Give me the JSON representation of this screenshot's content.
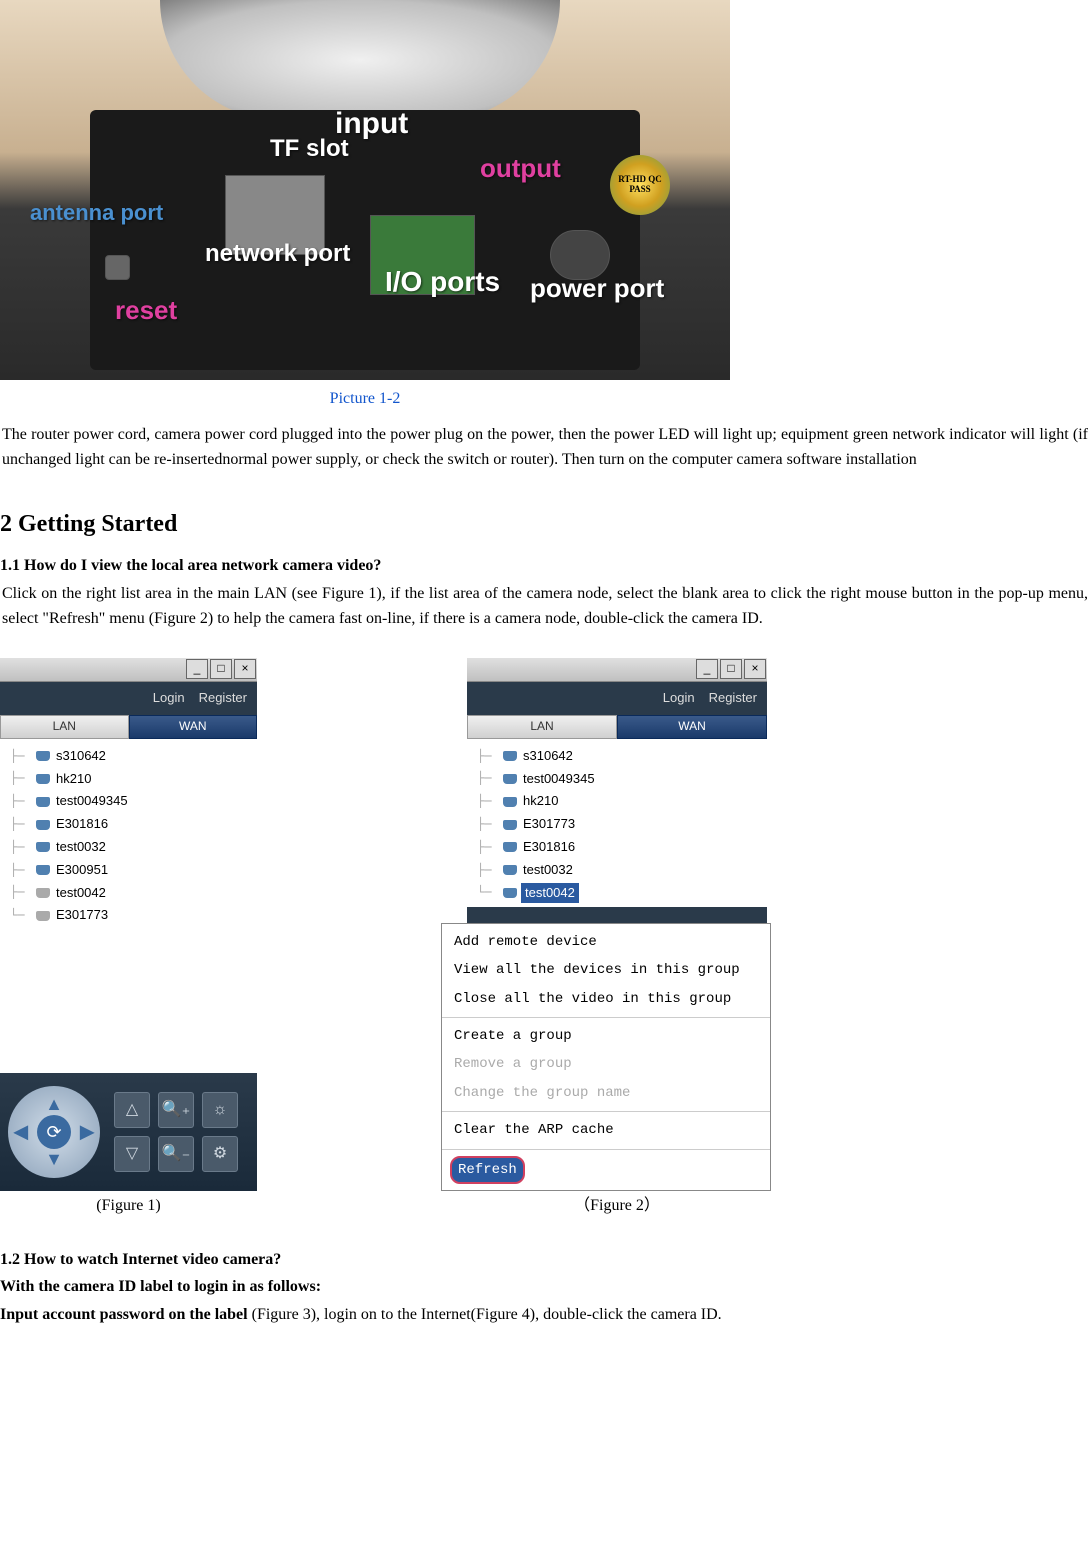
{
  "photo": {
    "labels": {
      "antenna": "antenna port",
      "reset": "reset",
      "tfslot": "TF slot",
      "input": "input",
      "output": "output",
      "network": "network port",
      "io": "I/O ports",
      "power": "power port",
      "sticker": "RT-HD QC PASS"
    },
    "caption": "Picture 1-2"
  },
  "intro_paragraph": "The router power cord, camera power cord plugged into the power plug on the power, then the power LED will light up; equipment green network indicator will light (if unchanged light can be re-insertednormal power supply, or check the switch or router). Then turn on the computer camera software installation",
  "section2": {
    "heading": "2 Getting Started",
    "sub1": {
      "title": "1.1 How do I view the local area network camera video?",
      "text": "Click on the right list area in the main LAN (see Figure 1), if the list area of the camera node, select the blank area to click the right mouse button in the pop-up menu, select \"Refresh\" menu (Figure 2) to help the camera fast on-line, if there is a camera node, double-click the camera ID."
    },
    "figure1": {
      "login": "Login",
      "register": "Register",
      "tab_lan": "LAN",
      "tab_wan": "WAN",
      "tree": [
        {
          "id": "s310642",
          "online": true
        },
        {
          "id": "hk210",
          "online": true
        },
        {
          "id": "test0049345",
          "online": true
        },
        {
          "id": "E301816",
          "online": true
        },
        {
          "id": "test0032",
          "online": true
        },
        {
          "id": "E300951",
          "online": true
        },
        {
          "id": "test0042",
          "online": false
        },
        {
          "id": "E301773",
          "online": false
        }
      ],
      "caption": "(Figure 1)"
    },
    "figure2": {
      "login": "Login",
      "register": "Register",
      "tab_lan": "LAN",
      "tab_wan": "WAN",
      "tree": [
        {
          "id": "s310642",
          "online": true,
          "selected": false
        },
        {
          "id": "test0049345",
          "online": true,
          "selected": false
        },
        {
          "id": "hk210",
          "online": true,
          "selected": false
        },
        {
          "id": "E301773",
          "online": true,
          "selected": false
        },
        {
          "id": "E301816",
          "online": true,
          "selected": false
        },
        {
          "id": "test0032",
          "online": true,
          "selected": false
        },
        {
          "id": "test0042",
          "online": true,
          "selected": true
        }
      ],
      "menu": {
        "sect1": [
          {
            "label": "Add remote device",
            "enabled": true
          },
          {
            "label": "View all the devices in this group",
            "enabled": true
          },
          {
            "label": "Close all the video in this group",
            "enabled": true
          }
        ],
        "sect2": [
          {
            "label": "Create a group",
            "enabled": true
          },
          {
            "label": "Remove a group",
            "enabled": false
          },
          {
            "label": "Change the group name",
            "enabled": false
          }
        ],
        "sect3": [
          {
            "label": "Clear the ARP cache",
            "enabled": true
          }
        ],
        "highlight": "Refresh"
      },
      "caption": "（Figure 2）"
    },
    "sub2": {
      "title": "1.2 How to watch Internet video camera?",
      "line1": "With the camera ID label to login in as follows:",
      "line2_bold": "Input account password on the label",
      "line2_rest": " (Figure 3), login on to the Internet(Figure 4), double-click the camera ID."
    }
  }
}
